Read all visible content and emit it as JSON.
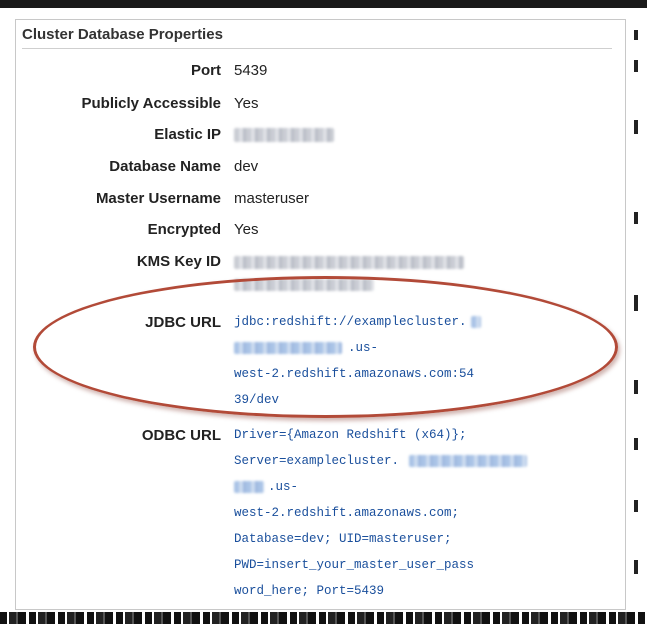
{
  "panel": {
    "title": "Cluster Database Properties",
    "rows": [
      {
        "label": "Port",
        "value": "5439"
      },
      {
        "label": "Publicly Accessible",
        "value": "Yes"
      },
      {
        "label": "Elastic IP",
        "value": ""
      },
      {
        "label": "Database Name",
        "value": "dev"
      },
      {
        "label": "Master Username",
        "value": "masteruser"
      },
      {
        "label": "Encrypted",
        "value": "Yes"
      },
      {
        "label": "KMS Key ID",
        "value": ""
      }
    ],
    "jdbc": {
      "label": "JDBC URL",
      "lines": [
        "jdbc:redshift://examplecluster.",
        ".us-",
        "west-2.redshift.amazonaws.com:54",
        "39/dev"
      ]
    },
    "odbc": {
      "label": "ODBC URL",
      "lines": [
        "Driver={Amazon Redshift (x64)};",
        "Server=examplecluster.",
        ".us-",
        "west-2.redshift.amazonaws.com;",
        "Database=dev; UID=masteruser;",
        "PWD=insert_your_master_user_pass",
        "word_here; Port=5439"
      ]
    }
  },
  "colors": {
    "highlight_ellipse": "#b24a38",
    "link_text": "#1a4f9c"
  }
}
